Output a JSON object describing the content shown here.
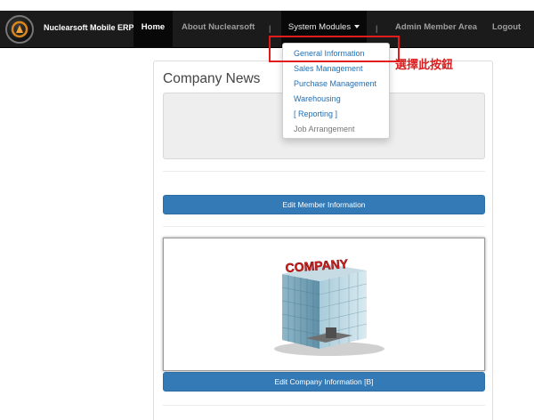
{
  "navbar": {
    "brand": "Nuclearsoft Mobile ERP",
    "items": [
      {
        "label": "Home"
      },
      {
        "label": "About Nuclearsoft"
      },
      {
        "label": "System Modules"
      },
      {
        "label": "Admin Member Area"
      },
      {
        "label": "Logout"
      }
    ],
    "separator": "|"
  },
  "dropdown": {
    "items": [
      {
        "label": "General Information"
      },
      {
        "label": "Sales Management"
      },
      {
        "label": "Purchase Management"
      },
      {
        "label": "Warehousing"
      },
      {
        "label": "[ Reporting ]"
      },
      {
        "label": "Job Arrangement"
      }
    ]
  },
  "annotation": {
    "text": "選擇此按鈕",
    "color": "#e21b1b"
  },
  "main": {
    "news_title": "Company News",
    "edit_member_button": "Edit Member Information",
    "company_image_text": "COMPANY",
    "edit_company_button": "Edit Company Information [B]"
  },
  "colors": {
    "navbar_bg": "#1b1b1b",
    "primary": "#337ab7",
    "link": "#1f6fb5"
  }
}
